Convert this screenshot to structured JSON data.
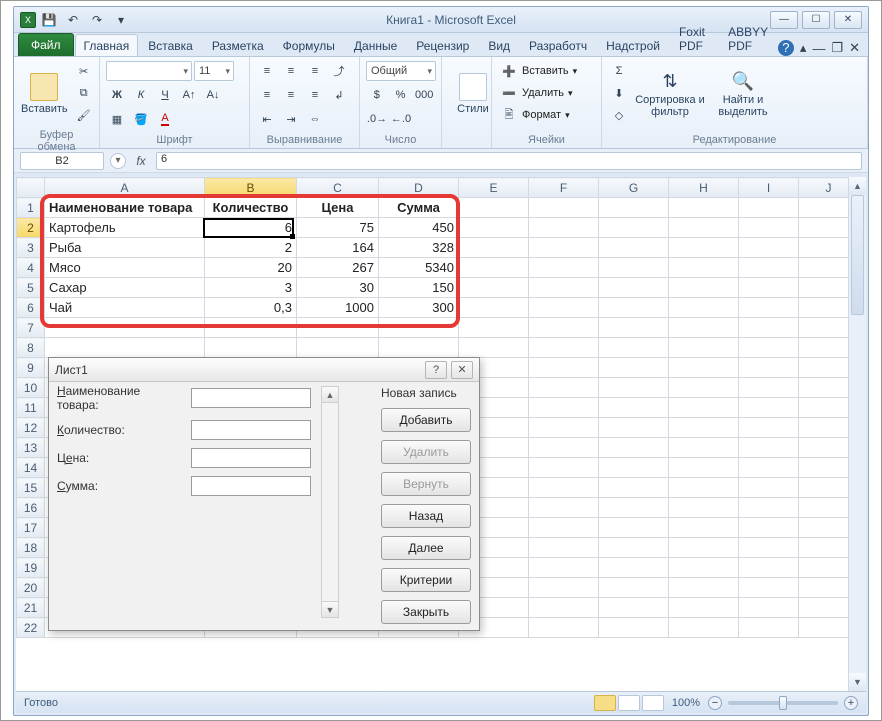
{
  "window": {
    "title": "Книга1  -  Microsoft Excel"
  },
  "qat": {
    "save_tt": "Сохранить",
    "undo_tt": "Отменить",
    "redo_tt": "Повторить"
  },
  "tabs": {
    "file": "Файл",
    "home": "Главная",
    "insert": "Вставка",
    "layout": "Разметка",
    "formulas": "Формулы",
    "data": "Данные",
    "review": "Рецензир",
    "view": "Вид",
    "developer": "Разработч",
    "addins": "Надстрой",
    "foxit": "Foxit PDF",
    "abbyy": "ABBYY PDF"
  },
  "ribbon": {
    "clipboard": {
      "paste": "Вставить",
      "title": "Буфер обмена"
    },
    "font": {
      "name_ph": "",
      "size": "11",
      "title": "Шрифт"
    },
    "alignment": {
      "title": "Выравнивание"
    },
    "number": {
      "format": "Общий",
      "title": "Число"
    },
    "styles": {
      "btn": "Стили",
      "title": ""
    },
    "cells": {
      "insert": "Вставить",
      "delete": "Удалить",
      "format": "Формат",
      "title": "Ячейки"
    },
    "editing": {
      "sort": "Сортировка и фильтр",
      "find": "Найти и выделить",
      "title": "Редактирование"
    }
  },
  "namebox": "B2",
  "formula_value": "6",
  "columns": [
    "A",
    "B",
    "C",
    "D",
    "E",
    "F",
    "G",
    "H",
    "I",
    "J"
  ],
  "row_numbers": [
    "1",
    "2",
    "3",
    "4",
    "5",
    "6",
    "7",
    "8",
    "9",
    "10",
    "11",
    "12",
    "13",
    "14",
    "15",
    "16",
    "17",
    "18",
    "19",
    "20",
    "21",
    "22"
  ],
  "table": {
    "headers": [
      "Наименование товара",
      "Количество",
      "Цена",
      "Сумма"
    ],
    "rows": [
      [
        "Картофель",
        "6",
        "75",
        "450"
      ],
      [
        "Рыба",
        "2",
        "164",
        "328"
      ],
      [
        "Мясо",
        "20",
        "267",
        "5340"
      ],
      [
        "Сахар",
        "3",
        "30",
        "150"
      ],
      [
        "Чай",
        "0,3",
        "1000",
        "300"
      ]
    ]
  },
  "form": {
    "title": "Лист1",
    "fields": {
      "name": "Наименование товара:",
      "qty": "Количество:",
      "price": "Цена:",
      "sum": "Сумма:"
    },
    "status": "Новая запись",
    "buttons": {
      "add": "Добавить",
      "delete": "Удалить",
      "restore": "Вернуть",
      "prev": "Назад",
      "next": "Далее",
      "criteria": "Критерии",
      "close": "Закрыть"
    }
  },
  "status": {
    "ready": "Готово",
    "zoom": "100%"
  }
}
